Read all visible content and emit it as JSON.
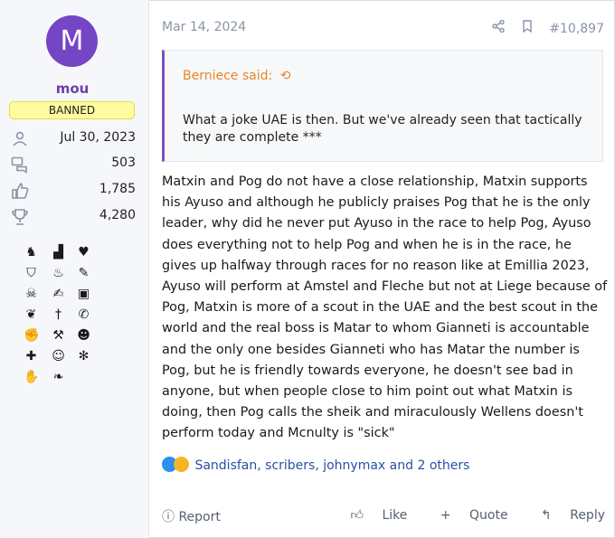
{
  "user": {
    "avatar_letter": "M",
    "avatar_color": "#7445c4",
    "name": "mou",
    "banner": "BANNED",
    "joined": "Jul 30, 2023",
    "messages": "503",
    "reactions": "1,785",
    "points": "4,280",
    "icons": {
      "joined": "user-icon",
      "messages": "chat-bubbles-icon",
      "reactions": "thumbs-up-icon",
      "points": "trophy-icon"
    }
  },
  "post": {
    "date": "Mar 14, 2024",
    "number": "#10,897",
    "share_icon": "share-icon",
    "bookmark_icon": "bookmark-icon",
    "quote": {
      "author": "Berniece said:",
      "text": "What a joke UAE is then. But we've already seen that tactically they are complete ***"
    },
    "body": "Matxin and Pog do not have a close relationship, Matxin supports his Ayuso and although he publicly praises Pog that he is the only leader, why did he never put Ayuso in the race to help Pog, Ayuso does everything not to help Pog and when he is in the race, he gives up halfway through races for no reason like at Emillia 2023, Ayuso will perform at Amstel and Fleche but not at Liege because of Pog, Matxin is more of a scout in the UAE and the best scout in the world and the real boss is Matar to whom Gianneti is accountable and the only one besides Gianneti who has Matar the number is Pog, but he is friendly towards everyone, he doesn't see bad in anyone, but when people close to him point out what Matxin is doing, then Pog calls the sheik and miraculously Wellens doesn't perform today and Mcnulty is \"sick\"",
    "reactions_text": "Sandisfan, scribers, johnymax and 2 others",
    "actions": {
      "report": "Report",
      "like": "Like",
      "quote": "Quote",
      "reply": "Reply"
    }
  },
  "colors": {
    "accent": "#7b52bf",
    "quote_author": "#e8862a",
    "link": "#2b4fa5",
    "muted": "#8a94a6",
    "banner_bg": "#fefc9e"
  }
}
